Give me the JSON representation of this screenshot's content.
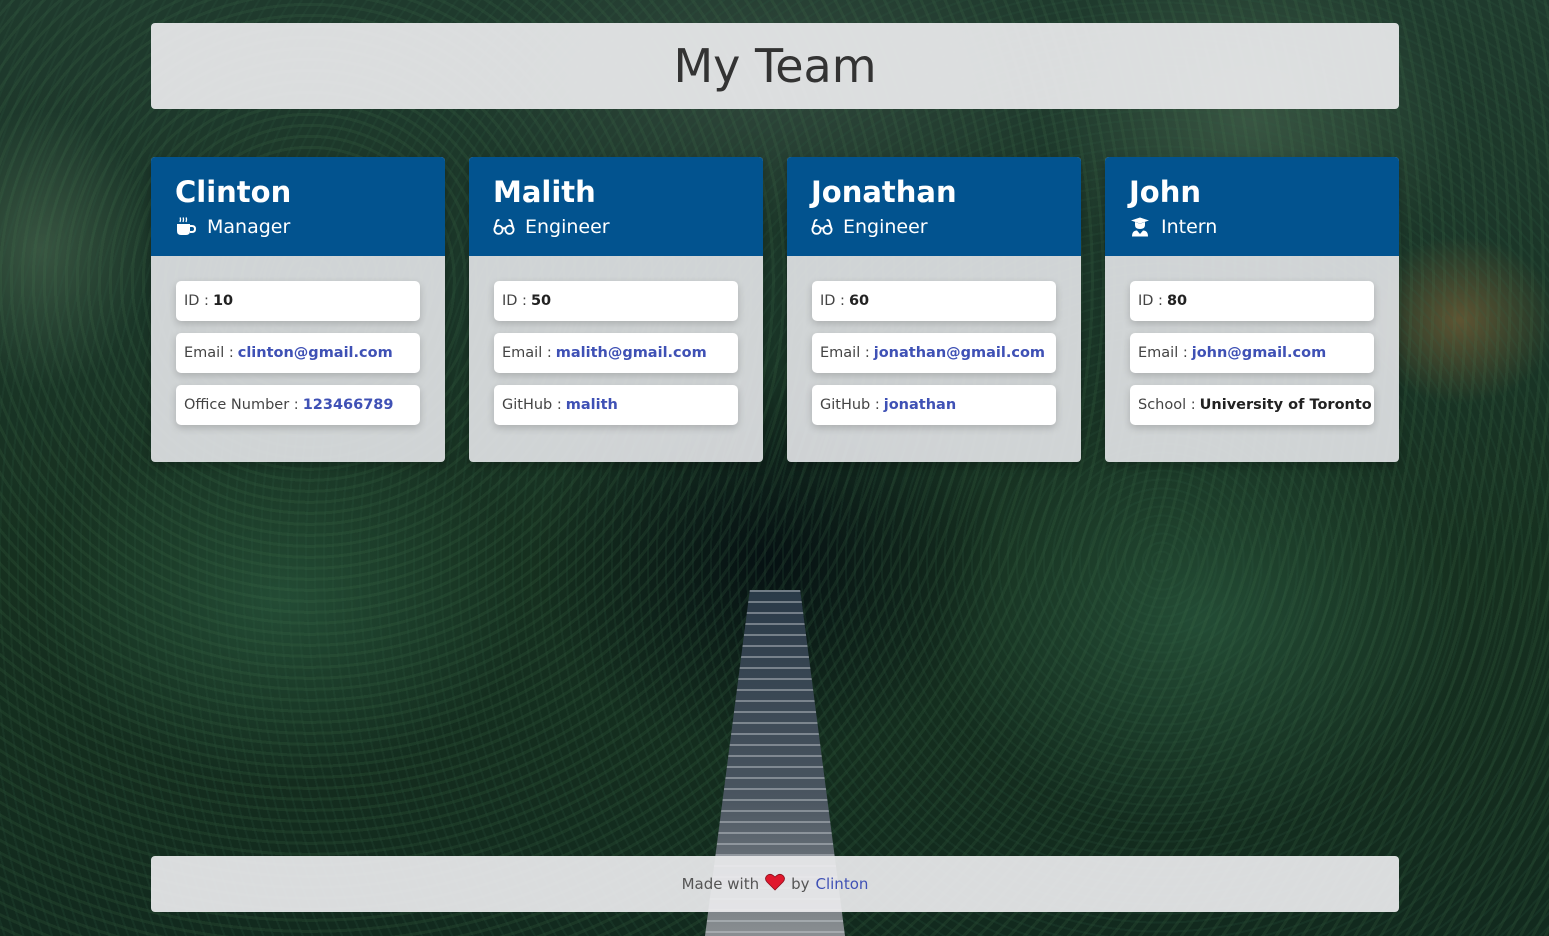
{
  "header": {
    "title": "My Team"
  },
  "team": [
    {
      "name": "Clinton",
      "role": "Manager",
      "role_icon": "coffee-icon",
      "id_label": "ID :",
      "id": "10",
      "email_label": "Email :",
      "email": "clinton@gmail.com",
      "extra_label": "Office Number :",
      "extra": "123466789"
    },
    {
      "name": "Malith",
      "role": "Engineer",
      "role_icon": "glasses-icon",
      "id_label": "ID :",
      "id": "50",
      "email_label": "Email :",
      "email": "malith@gmail.com",
      "extra_label": "GitHub :",
      "extra": "malith"
    },
    {
      "name": "Jonathan",
      "role": "Engineer",
      "role_icon": "glasses-icon",
      "id_label": "ID :",
      "id": "60",
      "email_label": "Email :",
      "email": "jonathan@gmail.com",
      "extra_label": "GitHub :",
      "extra": "jonathan"
    },
    {
      "name": "John",
      "role": "Intern",
      "role_icon": "graduate-icon",
      "id_label": "ID :",
      "id": "80",
      "email_label": "Email :",
      "email": "john@gmail.com",
      "extra_label": "School :",
      "extra": "University of Toronto"
    }
  ],
  "footer": {
    "made_with": "Made with",
    "by": "by",
    "author": "Clinton",
    "heart_color": "#e0182d"
  },
  "colors": {
    "card_header": "#02538f",
    "link": "#3f51b5"
  }
}
